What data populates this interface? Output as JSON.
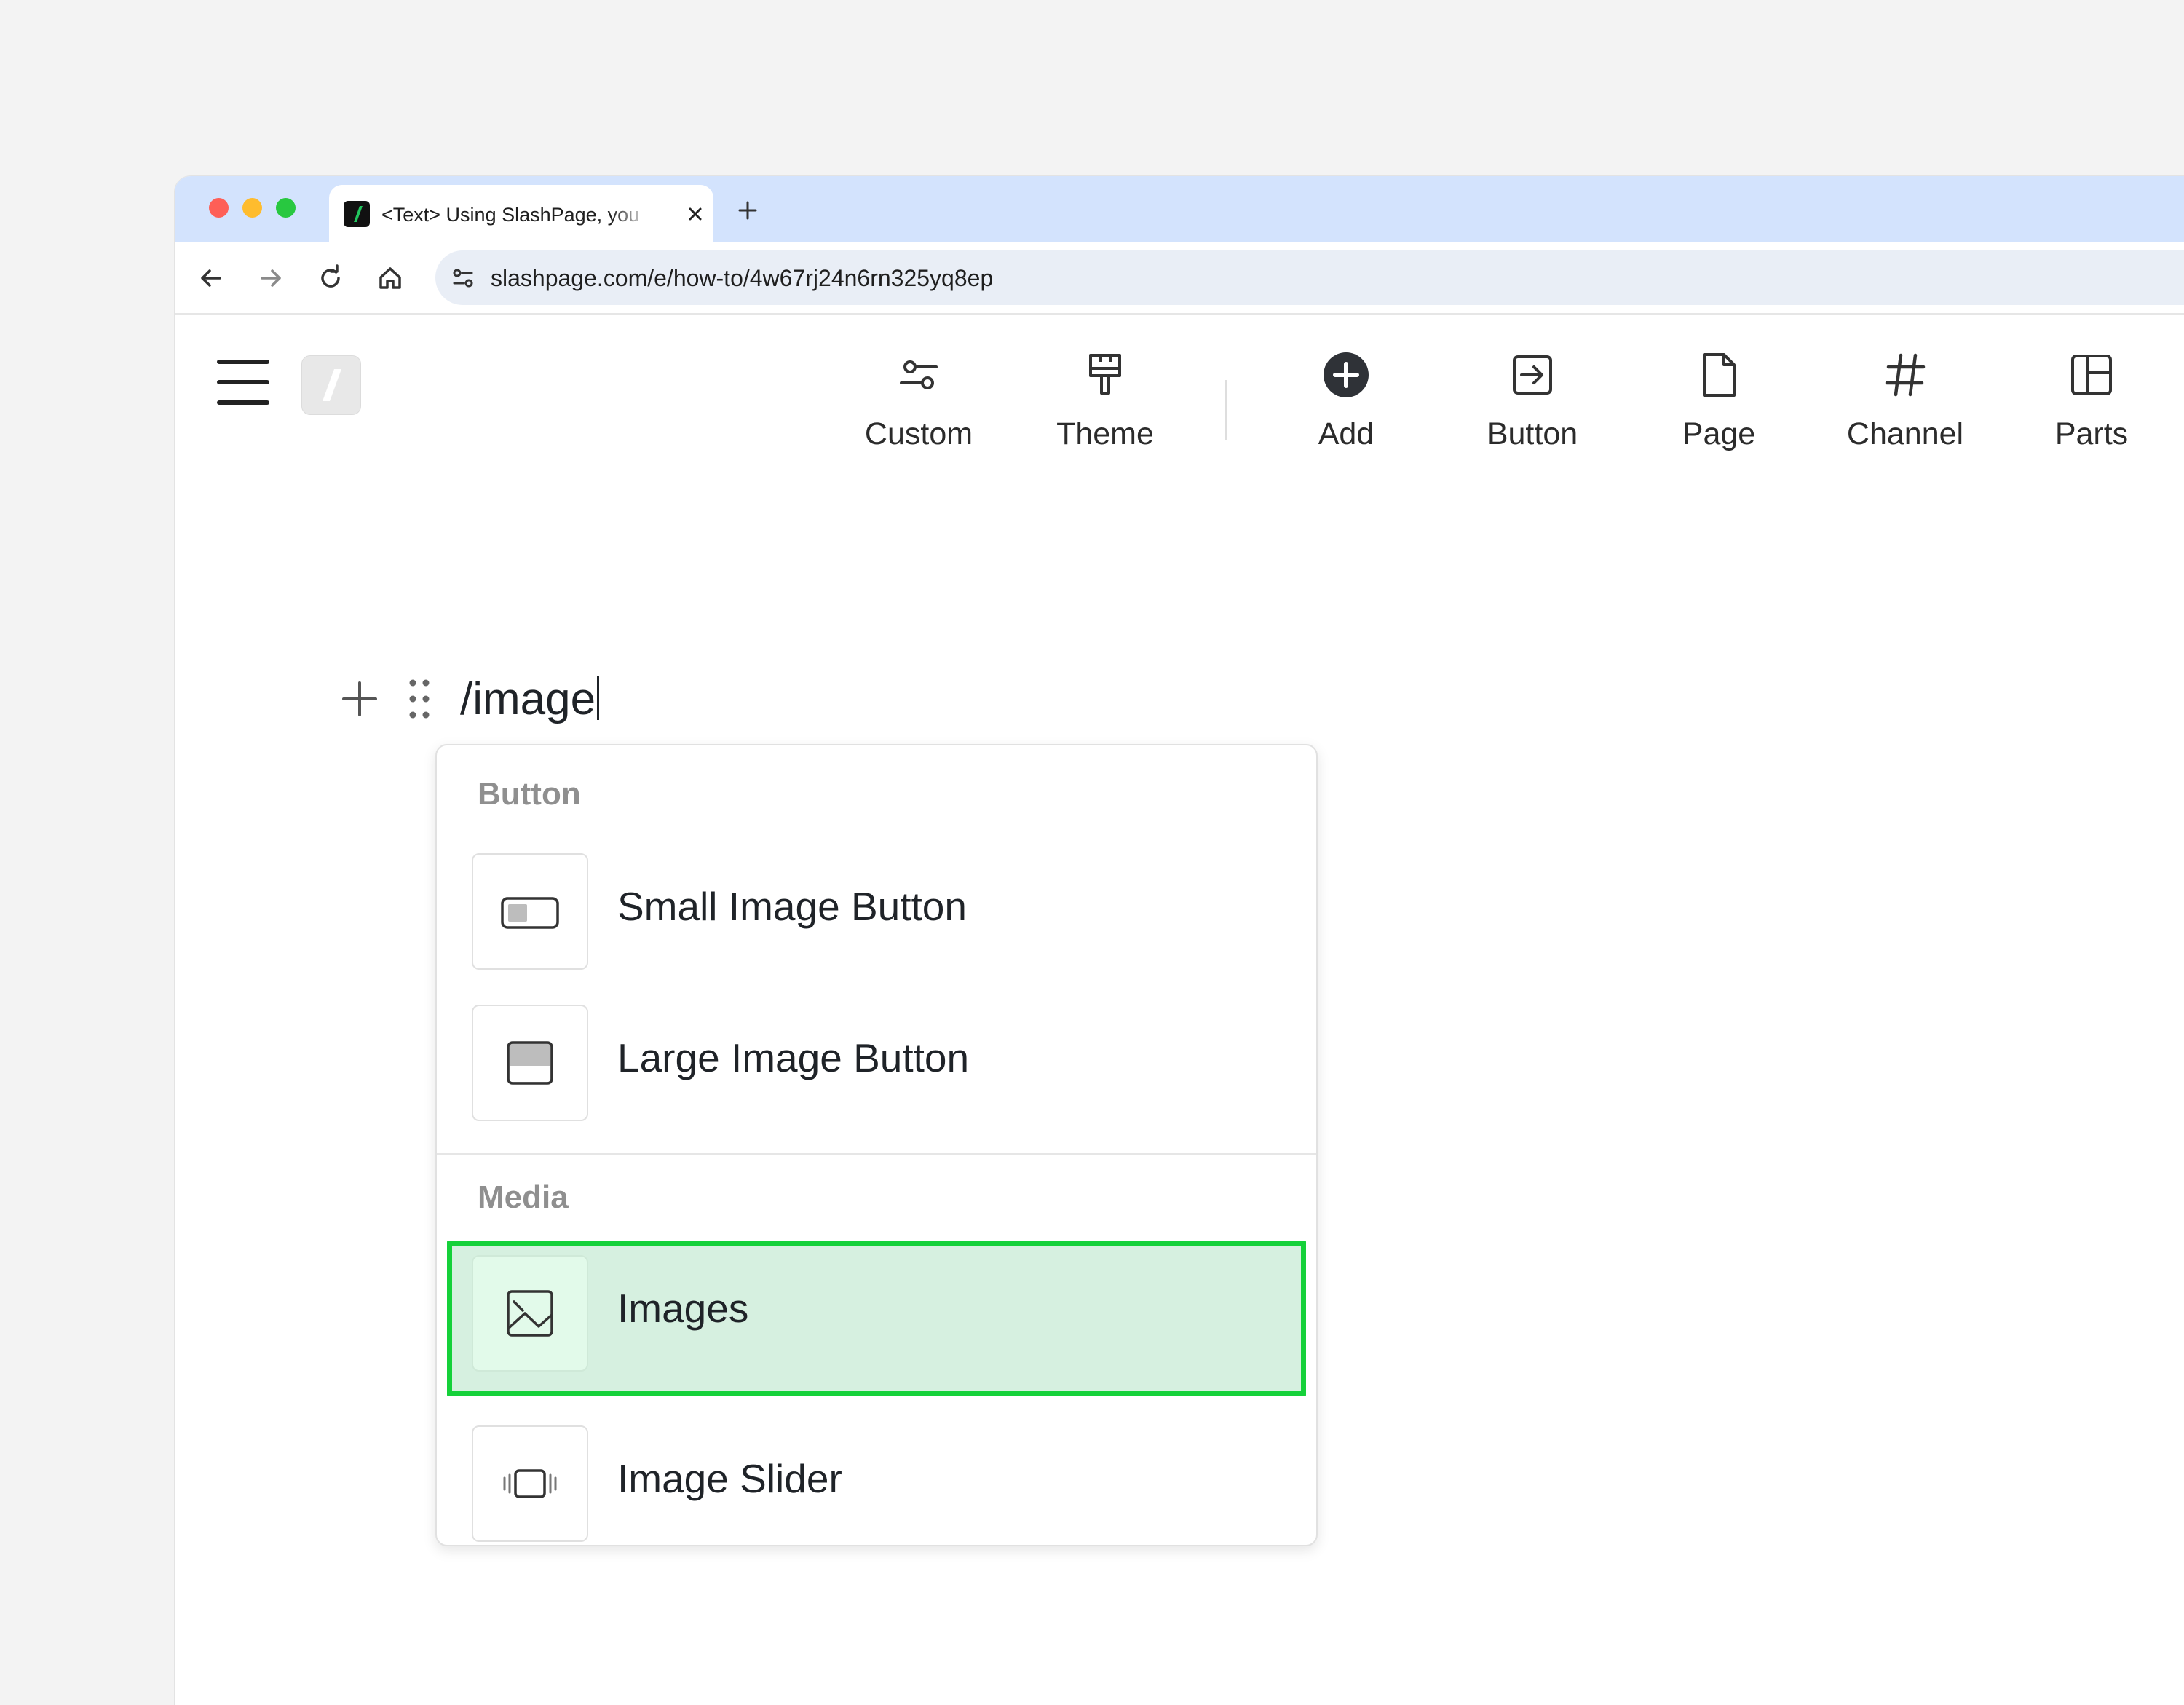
{
  "browser": {
    "tab_title": "<Text> Using SlashPage, you",
    "url": "slashpage.com/e/how-to/4w67rj24n6rn325yq8ep"
  },
  "toolbar_items": [
    {
      "label": "Custom",
      "icon": "sliders-icon"
    },
    {
      "label": "Theme",
      "icon": "paint-roller-icon"
    },
    {
      "label": "Add",
      "icon": "plus-circle-icon"
    },
    {
      "label": "Button",
      "icon": "arrow-right-box-icon"
    },
    {
      "label": "Page",
      "icon": "page-icon"
    },
    {
      "label": "Channel",
      "icon": "hash-icon"
    },
    {
      "label": "Parts",
      "icon": "layout-icon"
    }
  ],
  "editor": {
    "typed_text": "/image"
  },
  "menu": {
    "sections": [
      {
        "title": "Button",
        "items": [
          {
            "label": "Small Image Button",
            "icon": "small-image-button-icon"
          },
          {
            "label": "Large Image Button",
            "icon": "large-image-button-icon"
          }
        ]
      },
      {
        "title": "Media",
        "items": [
          {
            "label": "Images",
            "icon": "image-icon",
            "selected": true
          },
          {
            "label": "Image Slider",
            "icon": "image-slider-icon"
          }
        ]
      }
    ],
    "highlight_color": "#15d13a"
  }
}
